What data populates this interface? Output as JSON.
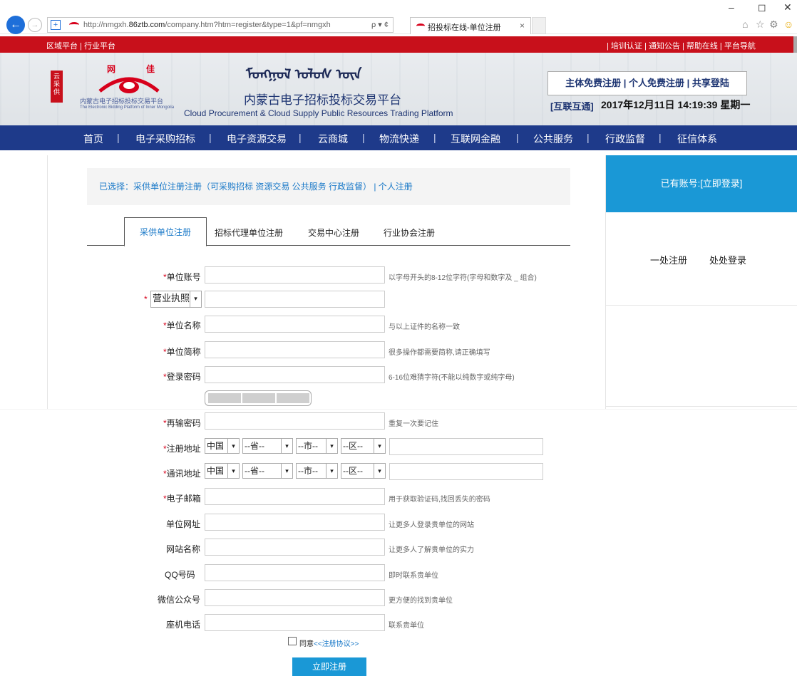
{
  "browser": {
    "url_prefix": "http://nmgxh.",
    "url_domain": "86ztb.com",
    "url_suffix": "/company.htm?htm=register&type=1&pf=nmgxh",
    "search_tools": "ρ ▾ ¢",
    "tab_title": "招投标在线-单位注册",
    "tab_close": "×",
    "back": "←",
    "forward": "→",
    "minimize": "–",
    "restore": "◻",
    "close": "✕",
    "home": "⌂",
    "star": "☆",
    "gear": "⚙",
    "smile": "☺"
  },
  "topbar": {
    "left": "区域平台 | 行业平台",
    "right": "| 培训认证 | 通知公告 | 帮助在线 | 平台导航"
  },
  "header": {
    "seal": "云采供",
    "brand_wang": "网",
    "brand_jia": "佳",
    "cn_name": "内蒙古电子招标投标交易平台",
    "en_name": "The Electronic Bidding Platform of Inner Mongolia",
    "mongol": "ᠮᠣᠩᠭᠣᠯ ᠤᠯᠤᠰ ᠦᠨ",
    "title": "内蒙古电子招标投标交易平台",
    "subtitle": "Cloud Procurement & Cloud Supply Public Resources Trading Platform",
    "reg_links": "主体免费注册 | 个人免费注册 | 共享登陆",
    "hulian": "[互联互通]",
    "datetime": "2017年12月11日 14:19:39 星期一"
  },
  "nav": {
    "items": [
      "首页",
      "电子采购招标",
      "电子资源交易",
      "云商城",
      "物流快递",
      "互联网金融",
      "公共服务",
      "行政监督",
      "征信体系"
    ],
    "sep": "|"
  },
  "selection": "已选择：采供单位注册注册（可采购招标  资源交易  公共服务  行政监督） | 个人注册",
  "tabs": [
    "采供单位注册",
    "招标代理单位注册",
    "交易中心注册",
    "行业协会注册"
  ],
  "login_box": "已有账号:[立即登录]",
  "slogan": [
    "一处注册",
    "处处登录"
  ],
  "form": {
    "account_label": "单位账号",
    "account_hint": "以字母开头的8-12位字符(字母和数字及 _ 组合)",
    "license_select": "营业执照",
    "name_label": "单位名称",
    "name_hint": "与以上证件的名称一致",
    "short_label": "单位简称",
    "short_hint": "很多操作都需要简称,请正确填写",
    "pwd_label": "登录密码",
    "pwd_hint": "6-16位难猜字符(不能以纯数字或纯字母)",
    "repwd_label": "再输密码",
    "repwd_hint": "重复一次要记住",
    "reg_addr_label": "注册地址",
    "mail_addr_label": "通讯地址",
    "country": "中国",
    "province": "--省--",
    "city": "--市--",
    "district": "--区--",
    "email_label": "电子邮箱",
    "email_hint": "用于获取验证码,找回丢失的密码",
    "site_label": "单位网址",
    "site_hint": "让更多人登录贵单位的网站",
    "site_name_label": "网站名称",
    "site_name_hint": "让更多人了解贵单位的实力",
    "qq_label": "QQ号码",
    "qq_hint": "即时联系贵单位",
    "wechat_label": "微信公众号",
    "wechat_hint": "更方便的找到贵单位",
    "phone_label": "座机电话",
    "phone_hint": "联系贵单位",
    "agree_text": "同意",
    "agree_link": "<<注册协议>>",
    "submit": "立即注册",
    "required_mark": "*",
    "arrow": "▾"
  }
}
